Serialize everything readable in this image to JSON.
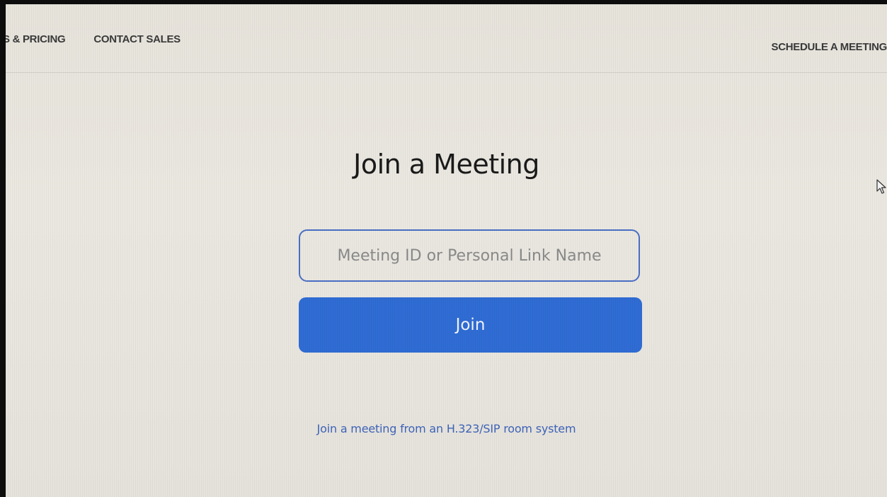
{
  "nav": {
    "plans_pricing": "S & PRICING",
    "contact_sales": "CONTACT SALES",
    "schedule_meeting": "SCHEDULE A MEETING"
  },
  "page": {
    "title": "Join a Meeting"
  },
  "form": {
    "meeting_id_placeholder": "Meeting ID or Personal Link Name",
    "meeting_id_value": "",
    "join_label": "Join"
  },
  "footer_link": {
    "h323_label": "Join a meeting from an H.323/SIP room system"
  },
  "colors": {
    "primary_button": "#2f6cd4",
    "input_border": "#4a6fc6",
    "link": "#3e64b8"
  },
  "icons": {
    "cursor": "mouse-pointer-icon"
  }
}
